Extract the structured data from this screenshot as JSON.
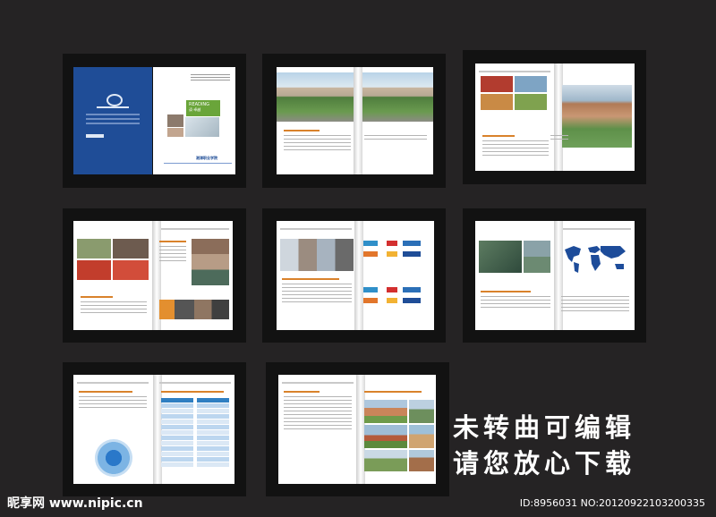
{
  "slogan": {
    "line1": "未转曲可编辑",
    "line2": "请您放心下载"
  },
  "watermark": {
    "site": "昵享网 www.nipic.cn",
    "id": "ID:8956031 NO:20120922103200335"
  },
  "spreads": [
    {
      "name": "cover",
      "reading_label": "READING",
      "reading_sub": "读·卓越",
      "school": "湘潭职业学院"
    },
    {
      "name": "campus-panorama"
    },
    {
      "name": "campus-photos"
    },
    {
      "name": "student-activities"
    },
    {
      "name": "partner-logos"
    },
    {
      "name": "world-map"
    },
    {
      "name": "data-table"
    },
    {
      "name": "buildings"
    }
  ],
  "colors": {
    "background": "#252324",
    "card": "#121212",
    "cover_blue": "#1f4d97",
    "accent_orange": "#d9822b",
    "accent_green": "#6aa53a"
  }
}
